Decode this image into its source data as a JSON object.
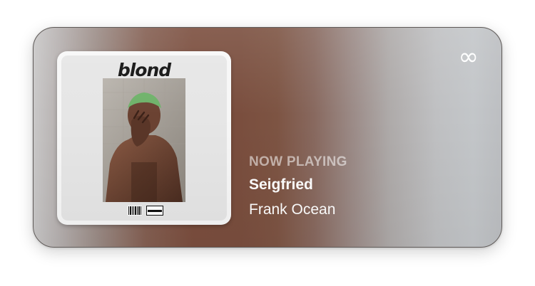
{
  "widget": {
    "status_label": "NOW PLAYING",
    "track_title": "Seigfried",
    "artist": "Frank Ocean",
    "repeat_icon": "infinity-icon"
  },
  "album": {
    "cover_title": "blond"
  },
  "colors": {
    "background_left": "#c9c8c8",
    "background_center": "#7b4e3e",
    "background_right": "#c3c6c9",
    "text_primary": "#ffffff"
  }
}
